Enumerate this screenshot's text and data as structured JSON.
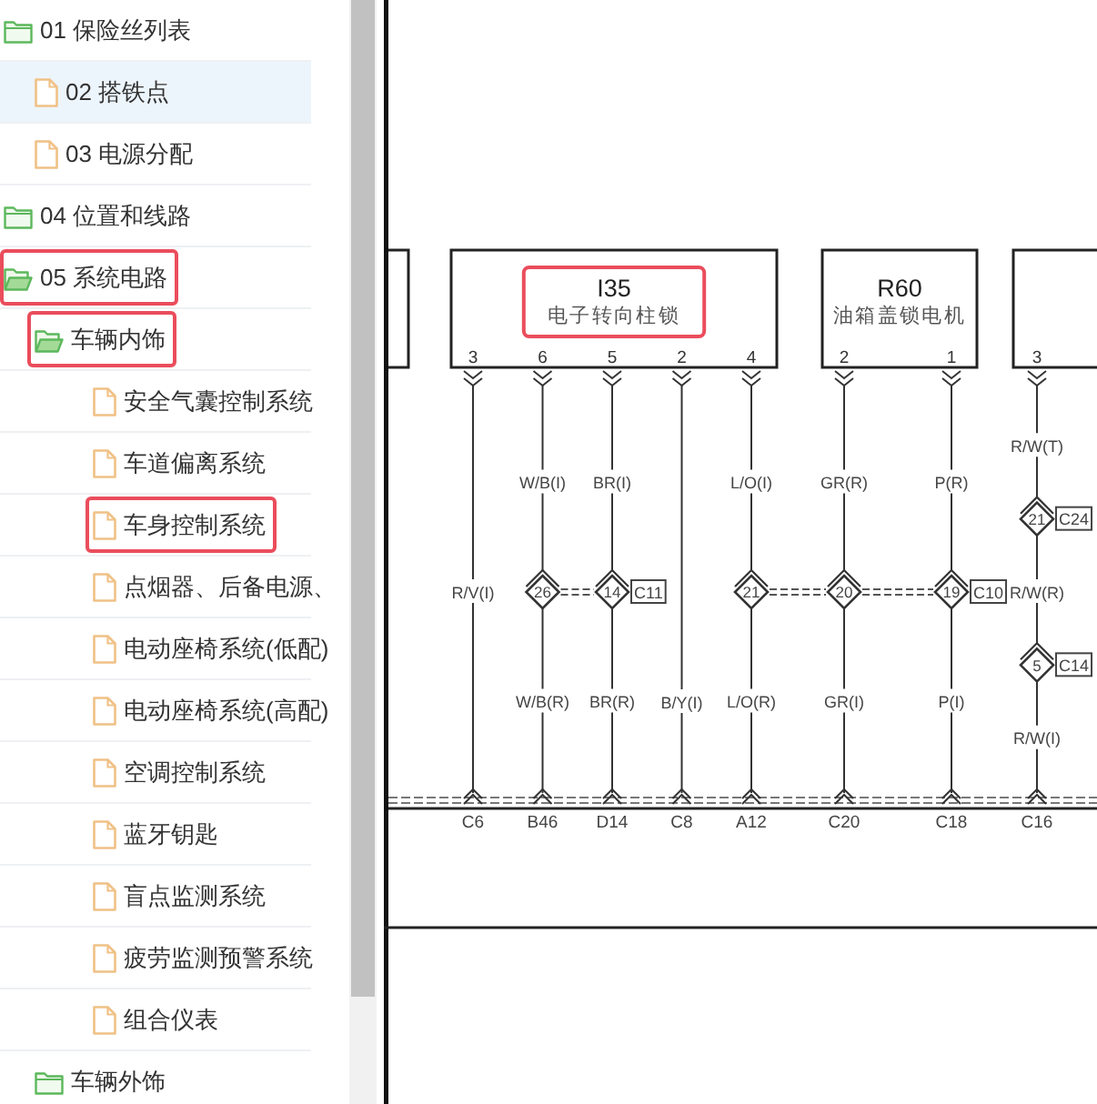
{
  "sidebar": {
    "tree": [
      {
        "kind": "folder",
        "label": "01 保险丝列表",
        "open": false,
        "selected": false,
        "children": [
          {
            "kind": "file",
            "label": "02 搭铁点",
            "selected": true
          },
          {
            "kind": "file",
            "label": "03 电源分配",
            "selected": false
          }
        ]
      },
      {
        "kind": "folder",
        "label": "04 位置和线路",
        "open": false,
        "selected": false
      },
      {
        "kind": "folder",
        "label": "05 系统电路",
        "open": true,
        "selected": false,
        "annotated": true,
        "children": [
          {
            "kind": "folder",
            "label": "车辆内饰",
            "open": true,
            "selected": false,
            "annotated": true,
            "children": [
              {
                "kind": "file",
                "label": "安全气囊控制系统",
                "selected": false
              },
              {
                "kind": "file",
                "label": "车道偏离系统",
                "selected": false
              },
              {
                "kind": "file",
                "label": "车身控制系统",
                "selected": false,
                "annotated": true
              },
              {
                "kind": "file",
                "label": "点烟器、后备电源、",
                "selected": false
              },
              {
                "kind": "file",
                "label": "电动座椅系统(低配)",
                "selected": false
              },
              {
                "kind": "file",
                "label": "电动座椅系统(高配)",
                "selected": false
              },
              {
                "kind": "file",
                "label": "空调控制系统",
                "selected": false
              },
              {
                "kind": "file",
                "label": "蓝牙钥匙",
                "selected": false
              },
              {
                "kind": "file",
                "label": "盲点监测系统",
                "selected": false
              },
              {
                "kind": "file",
                "label": "疲劳监测预警系统",
                "selected": false
              },
              {
                "kind": "file",
                "label": "组合仪表",
                "selected": false
              }
            ]
          },
          {
            "kind": "folder",
            "label": "车辆外饰",
            "open": false,
            "selected": false
          }
        ]
      }
    ]
  },
  "diagram": {
    "components": [
      {
        "code": "I35",
        "name": "电子转向柱锁",
        "annotated": true,
        "pins": [
          {
            "number": "3",
            "items": [
              {
                "kind": "label",
                "text": "R/V(I)"
              }
            ],
            "terminal": "C6"
          },
          {
            "number": "6",
            "items": [
              {
                "kind": "label",
                "text": "W/B(I)"
              },
              {
                "kind": "splice",
                "number": "26"
              },
              {
                "kind": "label",
                "text": "W/B(R)"
              }
            ],
            "terminal": "B46"
          },
          {
            "number": "5",
            "items": [
              {
                "kind": "label",
                "text": "BR(I)"
              },
              {
                "kind": "splice",
                "number": "14",
                "connector": "C11"
              },
              {
                "kind": "label",
                "text": "BR(R)"
              }
            ],
            "terminal": "D14"
          },
          {
            "number": "2",
            "items": [
              {
                "kind": "label",
                "text": "B/Y(I)",
                "lower": true
              }
            ],
            "terminal": "C8"
          },
          {
            "number": "4",
            "items": [
              {
                "kind": "label",
                "text": "L/O(I)"
              },
              {
                "kind": "splice",
                "number": "21"
              },
              {
                "kind": "label",
                "text": "L/O(R)"
              }
            ],
            "terminal": "A12"
          }
        ]
      },
      {
        "code": "R60",
        "name": "油箱盖锁电机",
        "pins": [
          {
            "number": "2",
            "items": [
              {
                "kind": "label",
                "text": "GR(R)"
              },
              {
                "kind": "splice",
                "number": "20"
              },
              {
                "kind": "label",
                "text": "GR(I)"
              }
            ],
            "terminal": "C20"
          },
          {
            "number": "1",
            "items": [
              {
                "kind": "label",
                "text": "P(R)"
              },
              {
                "kind": "splice",
                "number": "19",
                "connector": "C10"
              },
              {
                "kind": "label",
                "text": "P(I)"
              }
            ],
            "terminal": "C18"
          }
        ]
      },
      {
        "pins": [
          {
            "number": "3",
            "items": [
              {
                "kind": "label",
                "text": "R/W(T)"
              },
              {
                "kind": "splice",
                "number": "21",
                "connector": "C24"
              },
              {
                "kind": "label",
                "text": "R/W(R)"
              },
              {
                "kind": "splice",
                "number": "5",
                "connector": "C14"
              },
              {
                "kind": "label",
                "text": "R/W(I)"
              }
            ],
            "terminal": "C16"
          }
        ]
      }
    ]
  }
}
